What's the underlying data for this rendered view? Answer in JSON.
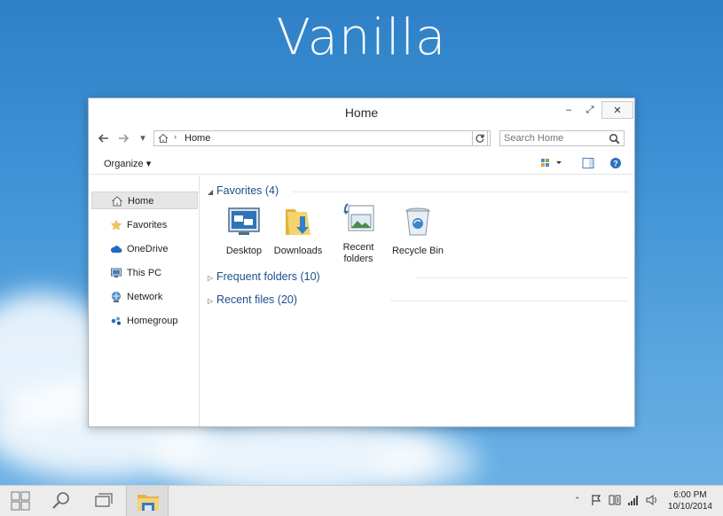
{
  "wallpaper": {
    "title": "Vanilla"
  },
  "window": {
    "title": "Home",
    "controls": {
      "minimize": "–",
      "maximize": "⤢",
      "close": "✕"
    },
    "nav": {
      "back": "🡐",
      "forward": "🡒",
      "recent": "▾",
      "up": ""
    },
    "address": {
      "path": "Home",
      "separator": "›",
      "dropdown": "▾",
      "refresh": "↻"
    },
    "search": {
      "placeholder": "Search Home"
    },
    "toolbar": {
      "organize": "Organize ▾"
    },
    "sidebar": {
      "items": [
        {
          "label": "Home",
          "icon": "home-icon"
        },
        {
          "label": "Favorites",
          "icon": "star-icon"
        },
        {
          "label": "OneDrive",
          "icon": "cloud-icon"
        },
        {
          "label": "This PC",
          "icon": "computer-icon"
        },
        {
          "label": "Network",
          "icon": "network-icon"
        },
        {
          "label": "Homegroup",
          "icon": "homegroup-icon"
        }
      ]
    },
    "content": {
      "groups": [
        {
          "label": "Favorites (4)",
          "arrow": "◢"
        },
        {
          "label": "Frequent folders (10)",
          "arrow": "▷"
        },
        {
          "label": "Recent files (20)",
          "arrow": "▷"
        }
      ],
      "favorites": [
        {
          "label": "Desktop",
          "icon": "desktop-icon"
        },
        {
          "label": "Downloads",
          "icon": "downloads-folder-icon"
        },
        {
          "label": "Recent folders",
          "icon": "recent-folders-icon"
        },
        {
          "label": "Recycle Bin",
          "icon": "recycle-bin-icon"
        }
      ]
    }
  },
  "taskbar": {
    "clock": {
      "time": "6:00 PM",
      "date": "10/10/2014"
    },
    "tray": {
      "chevron": "⌃"
    }
  },
  "colors": {
    "accent": "#1e4e8c",
    "folder": "#f2c94c",
    "taskbar": "#ececec"
  }
}
